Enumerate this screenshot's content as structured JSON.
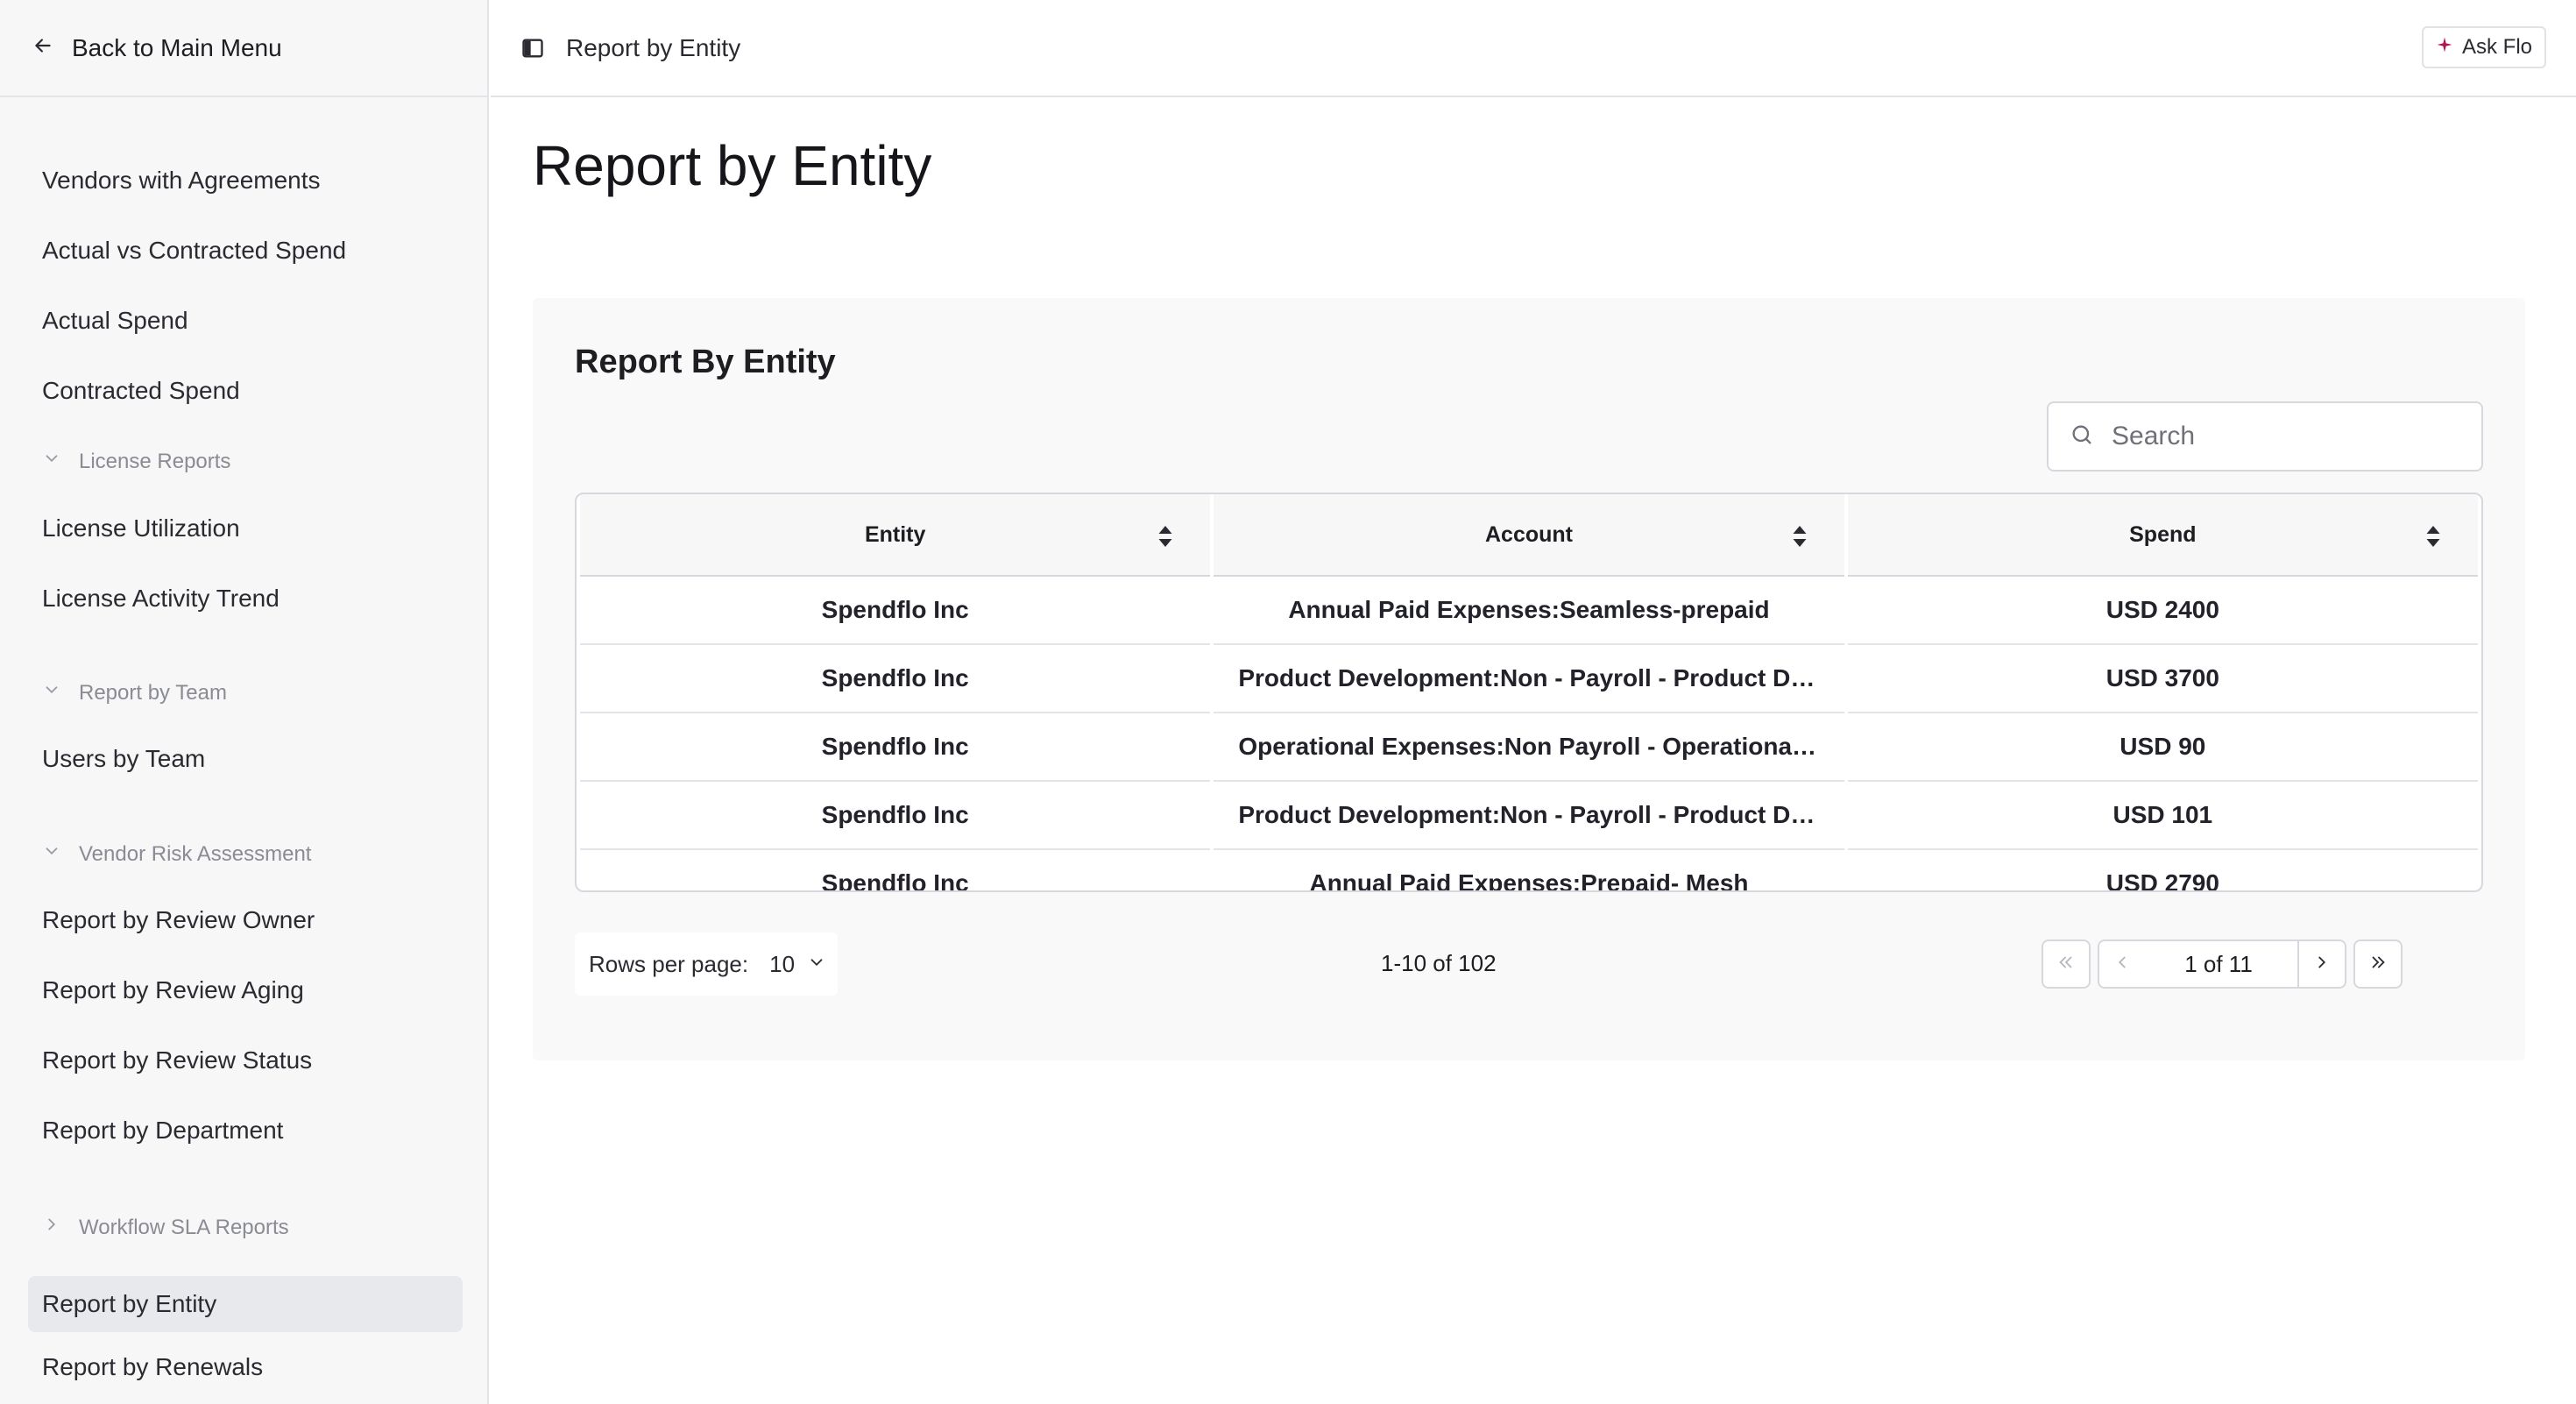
{
  "sidebar": {
    "back_label": "Back to Main Menu",
    "items": [
      {
        "label": "Vendors with Agreements"
      },
      {
        "label": "Actual vs Contracted Spend"
      },
      {
        "label": "Actual Spend"
      },
      {
        "label": "Contracted Spend"
      },
      {
        "label": "License Utilization"
      },
      {
        "label": "License Activity Trend"
      },
      {
        "label": "Users by Team"
      },
      {
        "label": "Report by Review Owner"
      },
      {
        "label": "Report by Review Aging"
      },
      {
        "label": "Report by Review Status"
      },
      {
        "label": "Report by Department"
      },
      {
        "label": "Report by Entity"
      },
      {
        "label": "Report by Renewals"
      }
    ],
    "sections": [
      {
        "label": "License Reports"
      },
      {
        "label": "Report by Team"
      },
      {
        "label": "Vendor Risk Assessment"
      },
      {
        "label": "Workflow SLA Reports"
      }
    ],
    "active_item": "Report by Entity"
  },
  "header": {
    "title": "Report by Entity",
    "ask_label": "Ask Flo"
  },
  "page": {
    "title": "Report by Entity"
  },
  "card": {
    "title": "Report By Entity",
    "search_placeholder": "Search"
  },
  "table": {
    "columns": [
      "Entity",
      "Account",
      "Spend"
    ],
    "rows": [
      [
        "Spendflo Inc",
        "Annual Paid Expenses:Seamless-prepaid",
        "USD 2400"
      ],
      [
        "Spendflo Inc",
        "Product Development:Non - Payroll - Product Development:Software Licensing and Fees",
        "USD 3700"
      ],
      [
        "Spendflo Inc",
        "Operational Expenses:Non Payroll - Operational Expenses:Software",
        "USD 90"
      ],
      [
        "Spendflo Inc",
        "Product Development:Non - Payroll - Product Development:Software Licensing and Fees",
        "USD 101"
      ],
      [
        "Spendflo Inc",
        "Annual Paid Expenses:Prepaid- Mesh",
        "USD 2790"
      ]
    ]
  },
  "pagination": {
    "rows_per_page_label": "Rows per page:",
    "rows_per_page_value": "10",
    "range": "1-10 of 102",
    "page_indicator": "1 of 11"
  },
  "colors": {
    "sidebar_bg": "#f7f7f8",
    "active_item_bg": "#e8e9ed",
    "accent_star": "#b3134f"
  }
}
